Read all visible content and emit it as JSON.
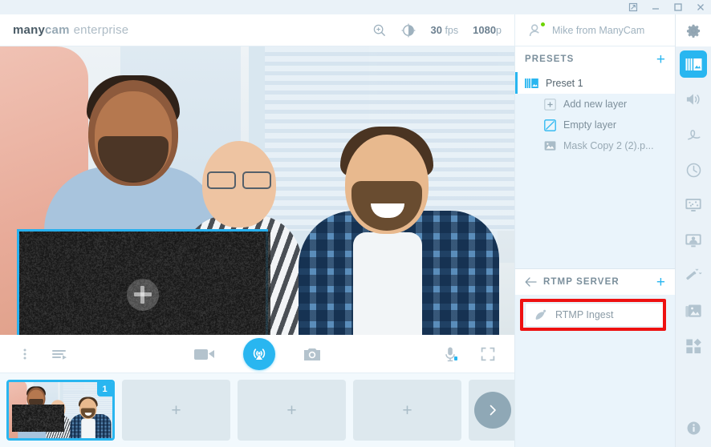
{
  "window": {
    "controls": [
      {
        "name": "restore-window-button",
        "icon": "restore-icon"
      },
      {
        "name": "minimize-window-button",
        "icon": "minimize-icon"
      },
      {
        "name": "maximize-window-button",
        "icon": "maximize-icon"
      },
      {
        "name": "close-window-button",
        "icon": "close-icon"
      }
    ]
  },
  "header": {
    "logo": {
      "bold": "many",
      "mid": "cam",
      "light": "enterprise"
    },
    "zoom_icon": "zoom-in-icon",
    "brightness_icon": "brightness-icon",
    "fps_value": "30",
    "fps_unit": "fps",
    "resolution_value": "1080",
    "resolution_unit": "p"
  },
  "user": {
    "name": "Mike from ManyCam",
    "avatar_icon": "user-avatar-icon",
    "status": "online",
    "status_color": "#6dd400"
  },
  "stage": {
    "selected_layer": {
      "name": "video-layer-placeholder",
      "border_color": "#27b0ee",
      "add_icon": "plus-icon"
    }
  },
  "controls": {
    "menu_icon": "more-options-icon",
    "playlist_icon": "playlist-icon",
    "record_icon": "video-camera-icon",
    "broadcast_icon": "broadcast-icon",
    "broadcast_color": "#29b6f0",
    "snapshot_icon": "camera-snapshot-icon",
    "mic_icon": "microphone-icon",
    "fullscreen_icon": "fullscreen-icon"
  },
  "strip": {
    "thumbnails": [
      {
        "type": "preset",
        "badge": "1",
        "selected": true
      },
      {
        "type": "empty",
        "add_label": "+"
      },
      {
        "type": "empty",
        "add_label": "+"
      },
      {
        "type": "empty",
        "add_label": "+"
      },
      {
        "type": "empty",
        "add_label": "+"
      }
    ],
    "next_icon": "chevron-right-icon"
  },
  "presets": {
    "title": "PRESETS",
    "add_icon": "plus-icon",
    "preset": {
      "label": "Preset 1",
      "icon": "preset-thumbnail-icon",
      "selected": true,
      "accent": "#29b6f0"
    },
    "layers": [
      {
        "label": "Add new layer",
        "icon": "add-layer-icon"
      },
      {
        "label": "Empty layer",
        "icon": "empty-layer-icon"
      },
      {
        "label": "Mask Copy 2 (2).p...",
        "icon": "image-layer-icon"
      }
    ]
  },
  "rtmp": {
    "back_icon": "back-arrow-icon",
    "title": "RTMP SERVER",
    "add_icon": "plus-icon",
    "items": [
      {
        "label": "RTMP Ingest",
        "icon": "satellite-dish-icon",
        "highlighted": true
      }
    ],
    "highlight_color": "#ee1111"
  },
  "sidebar": {
    "items": [
      {
        "name": "settings",
        "icon": "gear-icon",
        "active": false
      },
      {
        "name": "presets",
        "icon": "presets-icon",
        "active": true
      },
      {
        "name": "audio",
        "icon": "speaker-icon",
        "active": false
      },
      {
        "name": "effects",
        "icon": "squiggle-icon",
        "active": false
      },
      {
        "name": "scheduler",
        "icon": "clock-icon",
        "active": false
      },
      {
        "name": "chroma-key",
        "icon": "monitor-effects-icon",
        "active": false
      },
      {
        "name": "backgrounds",
        "icon": "person-screen-icon",
        "active": false
      },
      {
        "name": "magic-wand",
        "icon": "magic-wand-icon",
        "active": false
      },
      {
        "name": "media",
        "icon": "images-stack-icon",
        "active": false
      },
      {
        "name": "apps",
        "icon": "grid-apps-icon",
        "active": false
      }
    ],
    "info": {
      "name": "info",
      "icon": "info-icon"
    }
  }
}
